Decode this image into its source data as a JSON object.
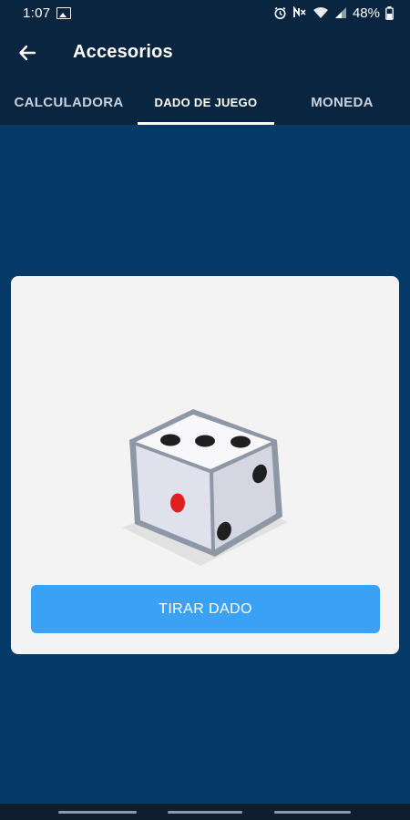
{
  "status_bar": {
    "time": "1:07",
    "battery": "48%",
    "icons": [
      "gallery-icon",
      "alarm-icon",
      "mute-icon",
      "wifi-icon",
      "signal-icon",
      "battery-icon"
    ]
  },
  "app_bar": {
    "title": "Accesorios",
    "back_icon": "arrow-left-icon"
  },
  "tabs": [
    {
      "label": "CALCULADORA",
      "active": false
    },
    {
      "label": "DADO DE JUEGO",
      "active": true
    },
    {
      "label": "MONEDA",
      "active": false
    }
  ],
  "dice": {
    "icon": "dice-icon",
    "top_face_pips": 3,
    "left_face_pips": 1,
    "right_face_pips": 2
  },
  "roll_button": {
    "label": "TIRAR DADO"
  },
  "colors": {
    "header": "#0a2540",
    "background": "#063a66",
    "card": "#f3f3f3",
    "button": "#3aa1f5",
    "red_pip": "#e02020"
  }
}
